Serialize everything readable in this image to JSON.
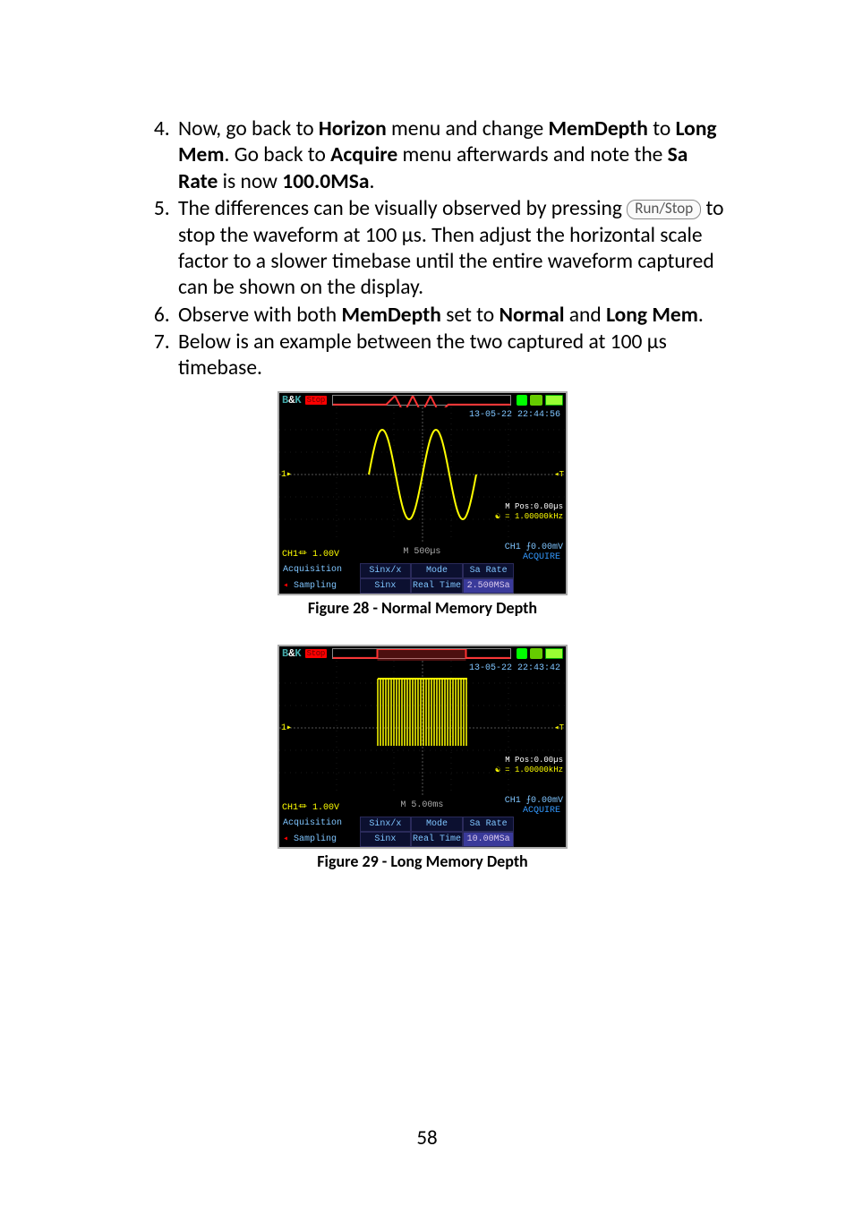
{
  "list_start": 4,
  "steps": [
    {
      "parts": [
        {
          "t": "Now, go back to "
        },
        {
          "b": "Horizon"
        },
        {
          "t": " menu and change "
        },
        {
          "b": "MemDepth"
        },
        {
          "t": " to "
        },
        {
          "b": "Long Mem"
        },
        {
          "t": ".  Go back to "
        },
        {
          "b": "Acquire"
        },
        {
          "t": " menu afterwards and note the "
        },
        {
          "b": "Sa Rate"
        },
        {
          "t": " is now "
        },
        {
          "b": "100.0MSa"
        },
        {
          "t": "."
        }
      ]
    },
    {
      "parts": [
        {
          "t": "The differences can be visually observed by pressing "
        },
        {
          "btn": "Run/Stop"
        },
        {
          "t": " to stop the waveform at 100 µs.  Then adjust the horizontal scale factor to a slower timebase until the entire waveform captured can be shown on the display."
        }
      ]
    },
    {
      "parts": [
        {
          "t": "Observe with both "
        },
        {
          "b": "MemDepth"
        },
        {
          "t": " set to "
        },
        {
          "b": "Normal"
        },
        {
          "t": " and "
        },
        {
          "b": "Long Mem"
        },
        {
          "t": "."
        }
      ]
    },
    {
      "parts": [
        {
          "t": "Below is an example between the two captured at 100 µs timebase."
        }
      ]
    }
  ],
  "fig1": {
    "caption": "Figure 28 - Normal Memory Depth",
    "date": "13-05-22 22:44:56",
    "mpos": "M Pos:0.00µs",
    "freq": "☯ = 1.00000kHz",
    "ch": "CH1⏛ 1.00V",
    "timebase": "M 500µs",
    "trig": "CH1 ⨍0.00mV",
    "acq": "ACQUIRE",
    "row1": {
      "c0a": "Acquisition",
      "c1": "Sinx/x",
      "c2": "Mode",
      "c3": "Sa Rate"
    },
    "row2": {
      "c0b": "Sampling",
      "c1": "Sinx",
      "c2": "Real Time",
      "c3": "2.500MSa"
    }
  },
  "fig2": {
    "caption": "Figure 29 - Long Memory Depth",
    "date": "13-05-22 22:43:42",
    "mpos": "M Pos:0.00µs",
    "freq": "☯ = 1.00000kHz",
    "ch": "CH1⏛ 1.00V",
    "timebase": "M 5.00ms",
    "trig": "CH1 ⨍0.00mV",
    "acq": "ACQUIRE",
    "row1": {
      "c0a": "Acquisition",
      "c1": "Sinx/x",
      "c2": "Mode",
      "c3": "Sa Rate"
    },
    "row2": {
      "c0b": "Sampling",
      "c1": "Sinx",
      "c2": "Real Time",
      "c3": "10.00MSa"
    }
  },
  "page_number": "58"
}
